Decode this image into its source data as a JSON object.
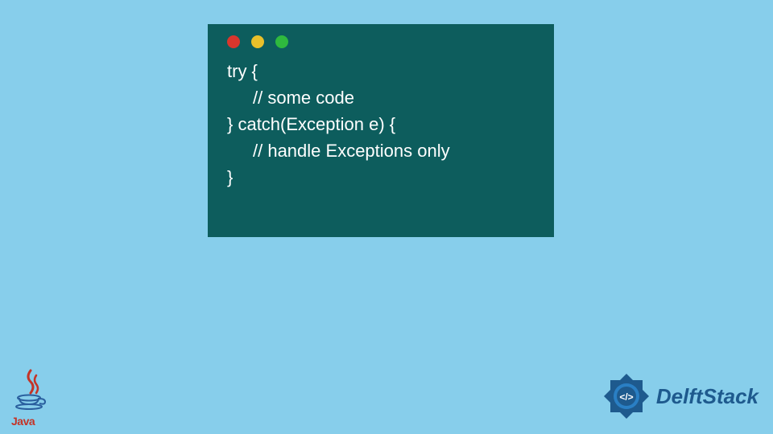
{
  "code": {
    "line1": "try {",
    "line2": "// some code",
    "line3": "} catch(Exception e) {",
    "line4": "// handle Exceptions only",
    "line5": "}"
  },
  "logos": {
    "java_text": "Java",
    "delft_text": "DelftStack"
  },
  "colors": {
    "background": "#87ceeb",
    "code_window": "#0d5d5d",
    "code_text": "#ffffff",
    "dot_red": "#d9362d",
    "dot_yellow": "#e9c02a",
    "dot_green": "#2fb93e",
    "java_red": "#c43427",
    "java_blue": "#2a5f9e",
    "delft_blue": "#1e5a8e"
  }
}
